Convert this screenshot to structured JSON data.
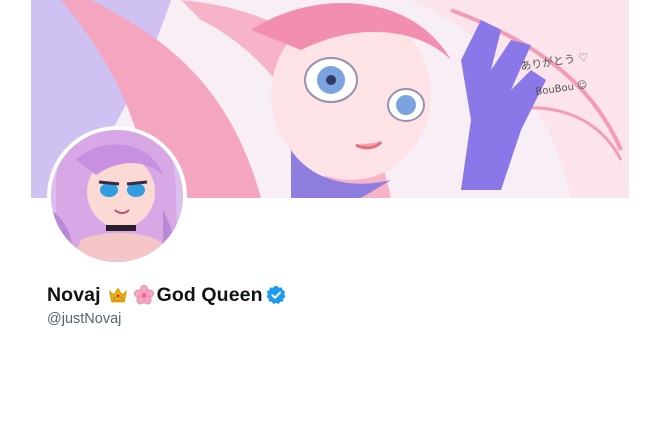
{
  "profile": {
    "name_first": "Novaj",
    "name_second": "God Queen",
    "handle": "@justNovaj",
    "verified": true
  },
  "icons": {
    "crown": "crown-emoji",
    "flower": "cherry-blossom-emoji",
    "verified": "verified-badge-icon"
  },
  "colors": {
    "verified": "#1d9bf0",
    "name": "#0f1419",
    "handle": "#536471"
  }
}
